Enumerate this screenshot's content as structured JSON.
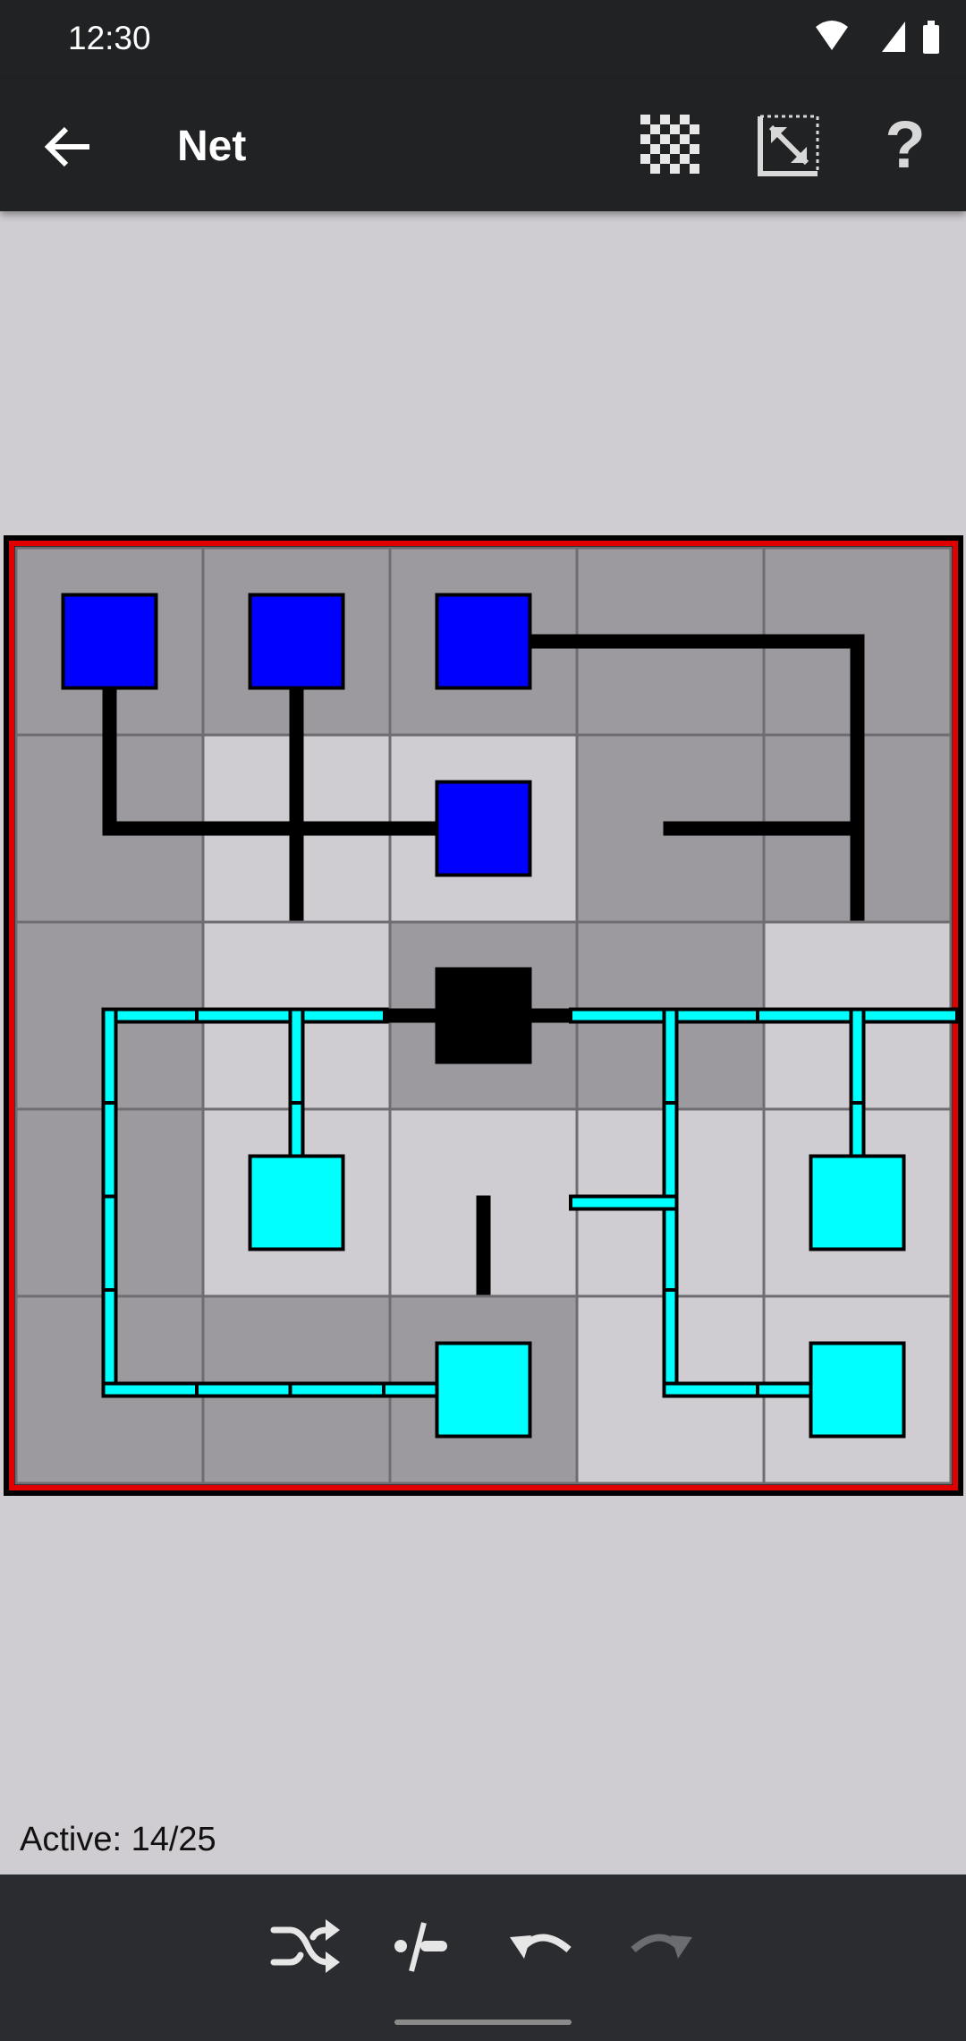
{
  "status_bar": {
    "time": "12:30"
  },
  "app_bar": {
    "title": "Net",
    "back_icon": "arrow-left-icon",
    "actions": [
      {
        "icon": "checkerboard-icon"
      },
      {
        "icon": "resize-diagonal-icon"
      },
      {
        "icon": "help-icon",
        "glyph": "?"
      }
    ]
  },
  "colors": {
    "powered": "#00ffff",
    "unpowered_terminal": "#0000ff",
    "source": "#000000",
    "border": "#e00000",
    "tile_dark": "#9c9a9e",
    "tile_light": "#cfcdd1"
  },
  "board": {
    "cols": 5,
    "rows": 5,
    "tiles": [
      {
        "row": 0,
        "col": 0,
        "shade": "dark",
        "terminal": "blue",
        "links": [
          "S"
        ]
      },
      {
        "row": 0,
        "col": 1,
        "shade": "dark",
        "terminal": "blue",
        "links": [
          "S"
        ]
      },
      {
        "row": 0,
        "col": 2,
        "shade": "dark",
        "terminal": "blue",
        "links": [
          "E"
        ]
      },
      {
        "row": 0,
        "col": 3,
        "shade": "dark",
        "links": [
          "W",
          "E"
        ]
      },
      {
        "row": 0,
        "col": 4,
        "shade": "dark",
        "links": [
          "W",
          "S"
        ]
      },
      {
        "row": 1,
        "col": 0,
        "shade": "dark",
        "links": [
          "N",
          "E"
        ]
      },
      {
        "row": 1,
        "col": 1,
        "shade": "light",
        "links": [
          "W",
          "E",
          "N",
          "S"
        ]
      },
      {
        "row": 1,
        "col": 2,
        "shade": "light",
        "terminal": "blue",
        "links": [
          "W"
        ]
      },
      {
        "row": 1,
        "col": 3,
        "shade": "dark",
        "links": [
          "E"
        ]
      },
      {
        "row": 1,
        "col": 4,
        "shade": "dark",
        "links": [
          "N",
          "S",
          "W"
        ]
      },
      {
        "row": 2,
        "col": 0,
        "shade": "dark",
        "powered": true,
        "links": [
          "E",
          "S"
        ]
      },
      {
        "row": 2,
        "col": 1,
        "shade": "light",
        "powered": true,
        "links": [
          "W",
          "E",
          "S"
        ]
      },
      {
        "row": 2,
        "col": 2,
        "shade": "dark",
        "source": true,
        "links": [
          "W",
          "E"
        ]
      },
      {
        "row": 2,
        "col": 3,
        "shade": "dark",
        "powered": true,
        "links": [
          "W",
          "E",
          "S"
        ]
      },
      {
        "row": 2,
        "col": 4,
        "shade": "light",
        "powered": true,
        "links": [
          "W",
          "E",
          "S"
        ]
      },
      {
        "row": 3,
        "col": 0,
        "shade": "dark",
        "powered": true,
        "links": [
          "N",
          "S"
        ]
      },
      {
        "row": 3,
        "col": 1,
        "shade": "light",
        "powered": true,
        "terminal": "cyan",
        "links": [
          "N"
        ]
      },
      {
        "row": 3,
        "col": 2,
        "shade": "light",
        "links": [
          "S"
        ]
      },
      {
        "row": 3,
        "col": 3,
        "shade": "light",
        "powered": true,
        "links": [
          "N",
          "S",
          "W"
        ]
      },
      {
        "row": 3,
        "col": 4,
        "shade": "light",
        "powered": true,
        "terminal": "cyan",
        "links": [
          "N"
        ]
      },
      {
        "row": 4,
        "col": 0,
        "shade": "dark",
        "powered": true,
        "links": [
          "N",
          "E"
        ]
      },
      {
        "row": 4,
        "col": 1,
        "shade": "dark",
        "powered": true,
        "links": [
          "W",
          "E"
        ]
      },
      {
        "row": 4,
        "col": 2,
        "shade": "dark",
        "powered": true,
        "terminal": "cyan",
        "links": [
          "W"
        ]
      },
      {
        "row": 4,
        "col": 3,
        "shade": "light",
        "powered": true,
        "links": [
          "N",
          "E"
        ]
      },
      {
        "row": 4,
        "col": 4,
        "shade": "light",
        "powered": true,
        "terminal": "cyan",
        "links": [
          "W"
        ]
      }
    ]
  },
  "footer": {
    "status": "Active: 14/25"
  },
  "bottom_bar": {
    "buttons": [
      {
        "icon": "shuffle-icon"
      },
      {
        "icon": "solve-icon"
      },
      {
        "icon": "undo-icon"
      },
      {
        "icon": "redo-icon",
        "disabled": true
      }
    ]
  }
}
